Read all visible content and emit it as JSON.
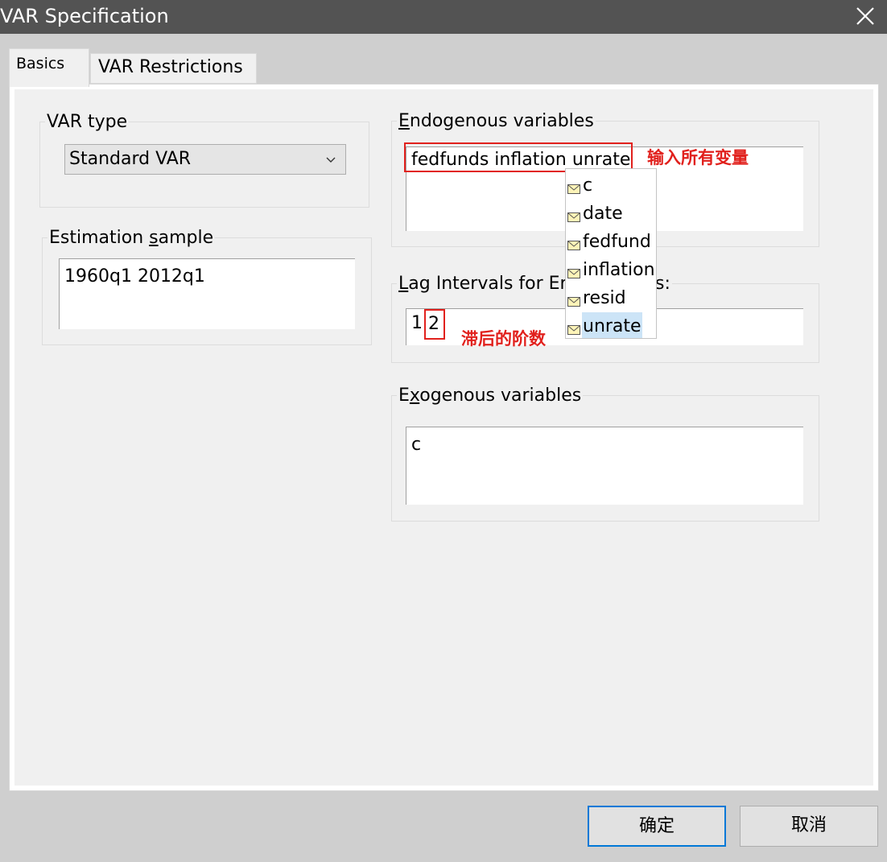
{
  "window": {
    "title": "VAR Specification",
    "close_icon": "close-icon"
  },
  "tabs": [
    {
      "label": "Basics",
      "selected": true
    },
    {
      "label": "VAR Restrictions",
      "selected": false
    }
  ],
  "var_type": {
    "label": "VAR type",
    "value": "Standard VAR",
    "icon": "chevron-down-icon"
  },
  "estimation_sample": {
    "label_before": "Estimation ",
    "label_mnemonic": "s",
    "label_after": "ample",
    "value": "1960q1 2012q1"
  },
  "endogenous": {
    "label_mnemonic": "E",
    "label_after": "ndogenous variables",
    "value": "fedfunds inflation unrate"
  },
  "lag_intervals": {
    "label_mnemonic": "L",
    "label_after": "ag Intervals for En",
    "label_tail": "s:",
    "value_start": "1",
    "value_end": "2"
  },
  "exogenous": {
    "label_before": "E",
    "label_mnemonic": "x",
    "label_after": "ogenous variables",
    "value": "c"
  },
  "autocomplete": {
    "icon": "series-icon",
    "items": [
      "c",
      "date",
      "fedfund",
      "inflation",
      "resid",
      "unrate"
    ],
    "selected": "unrate"
  },
  "annotations": {
    "endogenous_note": "输入所有变量",
    "lag_note": "滞后的阶数",
    "color": "#e1211d"
  },
  "buttons": {
    "ok": "确定",
    "cancel": "取消"
  },
  "colors": {
    "titlebar": "#535353",
    "dialog": "#f0f0f0",
    "focus": "#0078d7",
    "selection": "#cce4f7"
  }
}
